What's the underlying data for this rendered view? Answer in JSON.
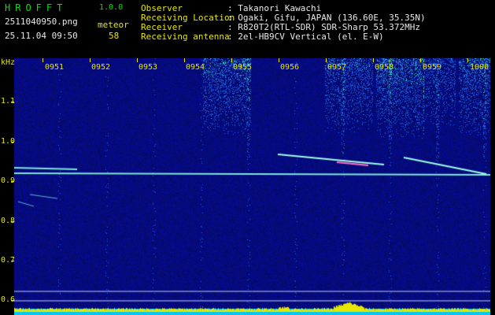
{
  "app": {
    "logo": "HROFFT",
    "version": "1.0.0"
  },
  "file": {
    "name": "2511040950.png",
    "datetime": "25.11.04 09:50"
  },
  "meteor": {
    "label": "meteor",
    "count": "58"
  },
  "info": [
    {
      "key": "Observer",
      "value": ": Takanori Kawachi"
    },
    {
      "key": "Receiving Location",
      "value": ": Ogaki, Gifu, JAPAN (136.60E, 35.35N)"
    },
    {
      "key": "Receiver",
      "value": ": R820T2(RTL-SDR) SDR-Sharp 53.372MHz"
    },
    {
      "key": "Receiving antenna",
      "value": ": 2el-HB9CV Vertical (el. E-W)"
    }
  ],
  "axis": {
    "unit": "kHz",
    "y_ticks": [
      "1.1",
      "1.0",
      "0.9",
      "0.8",
      "0.7",
      "0.6"
    ],
    "x_ticks": [
      "0951",
      "0952",
      "0953",
      "0954",
      "0955",
      "0956",
      "0957",
      "0958",
      "0959",
      "1000"
    ]
  },
  "colors": {
    "background": "#000000",
    "spectrum_base": "#05127a",
    "header_green": "#00e600",
    "header_yellow": "#e6e600",
    "echo_trace": "#a0ffe0",
    "level_bar": "#00c8ff"
  }
}
